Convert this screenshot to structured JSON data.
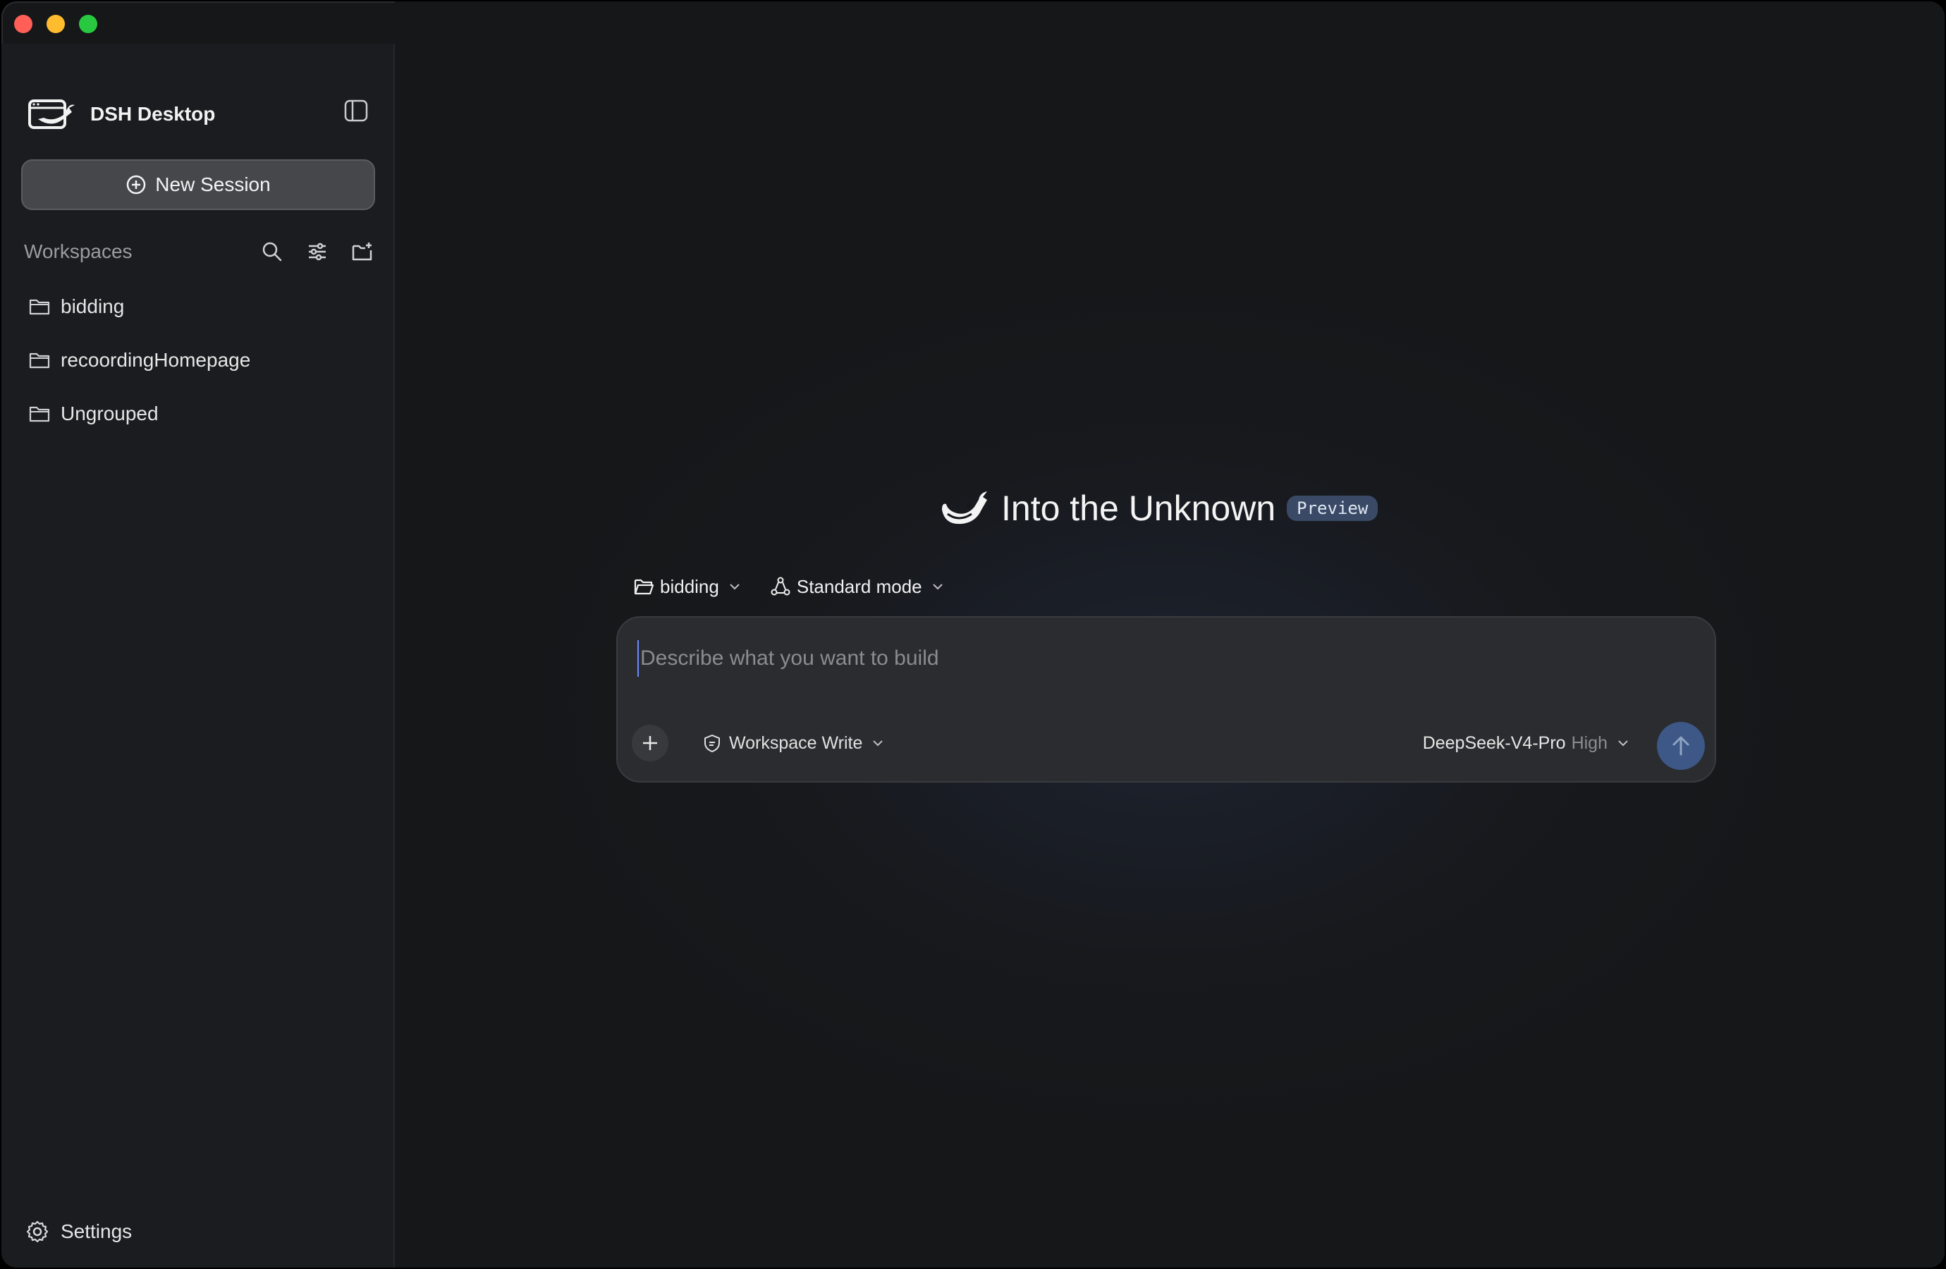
{
  "window": {
    "traffic_lights": [
      "close",
      "minimize",
      "zoom"
    ]
  },
  "sidebar": {
    "brand_title": "DSH Desktop",
    "new_session_label": "New Session",
    "workspaces_label": "Workspaces",
    "workspace_items": [
      {
        "label": "bidding",
        "icon": "folder-icon"
      },
      {
        "label": "recoordingHomepage",
        "icon": "folder-icon"
      },
      {
        "label": "Ungrouped",
        "icon": "folder-icon"
      }
    ],
    "settings_label": "Settings"
  },
  "main": {
    "hero_title": "Into the Unknown",
    "preview_badge": "Preview",
    "workspace_selector": "bidding",
    "mode_selector": "Standard mode",
    "composer": {
      "placeholder": "Describe what you want to build",
      "value": "",
      "permission": "Workspace Write",
      "model": "DeepSeek-V4-Pro",
      "effort": "High"
    }
  },
  "colors": {
    "accent": "#3d5886",
    "badge_bg": "#3a4a66",
    "sidebar_bg": "#1b1c1f",
    "main_bg": "#161719"
  }
}
